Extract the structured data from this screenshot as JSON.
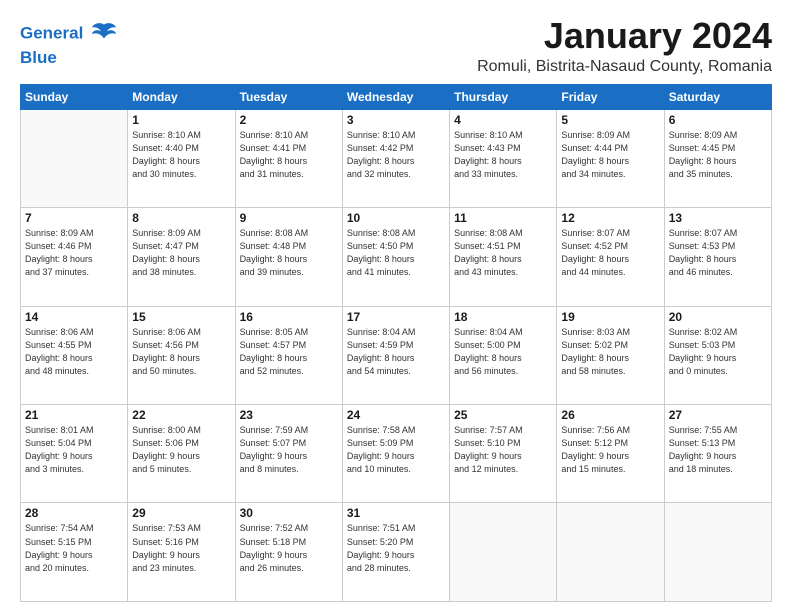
{
  "header": {
    "logo_line1": "General",
    "logo_line2": "Blue",
    "month_year": "January 2024",
    "location": "Romuli, Bistrita-Nasaud County, Romania"
  },
  "days_of_week": [
    "Sunday",
    "Monday",
    "Tuesday",
    "Wednesday",
    "Thursday",
    "Friday",
    "Saturday"
  ],
  "weeks": [
    [
      {
        "day": "",
        "info": ""
      },
      {
        "day": "1",
        "info": "Sunrise: 8:10 AM\nSunset: 4:40 PM\nDaylight: 8 hours\nand 30 minutes."
      },
      {
        "day": "2",
        "info": "Sunrise: 8:10 AM\nSunset: 4:41 PM\nDaylight: 8 hours\nand 31 minutes."
      },
      {
        "day": "3",
        "info": "Sunrise: 8:10 AM\nSunset: 4:42 PM\nDaylight: 8 hours\nand 32 minutes."
      },
      {
        "day": "4",
        "info": "Sunrise: 8:10 AM\nSunset: 4:43 PM\nDaylight: 8 hours\nand 33 minutes."
      },
      {
        "day": "5",
        "info": "Sunrise: 8:09 AM\nSunset: 4:44 PM\nDaylight: 8 hours\nand 34 minutes."
      },
      {
        "day": "6",
        "info": "Sunrise: 8:09 AM\nSunset: 4:45 PM\nDaylight: 8 hours\nand 35 minutes."
      }
    ],
    [
      {
        "day": "7",
        "info": "Sunrise: 8:09 AM\nSunset: 4:46 PM\nDaylight: 8 hours\nand 37 minutes."
      },
      {
        "day": "8",
        "info": "Sunrise: 8:09 AM\nSunset: 4:47 PM\nDaylight: 8 hours\nand 38 minutes."
      },
      {
        "day": "9",
        "info": "Sunrise: 8:08 AM\nSunset: 4:48 PM\nDaylight: 8 hours\nand 39 minutes."
      },
      {
        "day": "10",
        "info": "Sunrise: 8:08 AM\nSunset: 4:50 PM\nDaylight: 8 hours\nand 41 minutes."
      },
      {
        "day": "11",
        "info": "Sunrise: 8:08 AM\nSunset: 4:51 PM\nDaylight: 8 hours\nand 43 minutes."
      },
      {
        "day": "12",
        "info": "Sunrise: 8:07 AM\nSunset: 4:52 PM\nDaylight: 8 hours\nand 44 minutes."
      },
      {
        "day": "13",
        "info": "Sunrise: 8:07 AM\nSunset: 4:53 PM\nDaylight: 8 hours\nand 46 minutes."
      }
    ],
    [
      {
        "day": "14",
        "info": "Sunrise: 8:06 AM\nSunset: 4:55 PM\nDaylight: 8 hours\nand 48 minutes."
      },
      {
        "day": "15",
        "info": "Sunrise: 8:06 AM\nSunset: 4:56 PM\nDaylight: 8 hours\nand 50 minutes."
      },
      {
        "day": "16",
        "info": "Sunrise: 8:05 AM\nSunset: 4:57 PM\nDaylight: 8 hours\nand 52 minutes."
      },
      {
        "day": "17",
        "info": "Sunrise: 8:04 AM\nSunset: 4:59 PM\nDaylight: 8 hours\nand 54 minutes."
      },
      {
        "day": "18",
        "info": "Sunrise: 8:04 AM\nSunset: 5:00 PM\nDaylight: 8 hours\nand 56 minutes."
      },
      {
        "day": "19",
        "info": "Sunrise: 8:03 AM\nSunset: 5:02 PM\nDaylight: 8 hours\nand 58 minutes."
      },
      {
        "day": "20",
        "info": "Sunrise: 8:02 AM\nSunset: 5:03 PM\nDaylight: 9 hours\nand 0 minutes."
      }
    ],
    [
      {
        "day": "21",
        "info": "Sunrise: 8:01 AM\nSunset: 5:04 PM\nDaylight: 9 hours\nand 3 minutes."
      },
      {
        "day": "22",
        "info": "Sunrise: 8:00 AM\nSunset: 5:06 PM\nDaylight: 9 hours\nand 5 minutes."
      },
      {
        "day": "23",
        "info": "Sunrise: 7:59 AM\nSunset: 5:07 PM\nDaylight: 9 hours\nand 8 minutes."
      },
      {
        "day": "24",
        "info": "Sunrise: 7:58 AM\nSunset: 5:09 PM\nDaylight: 9 hours\nand 10 minutes."
      },
      {
        "day": "25",
        "info": "Sunrise: 7:57 AM\nSunset: 5:10 PM\nDaylight: 9 hours\nand 12 minutes."
      },
      {
        "day": "26",
        "info": "Sunrise: 7:56 AM\nSunset: 5:12 PM\nDaylight: 9 hours\nand 15 minutes."
      },
      {
        "day": "27",
        "info": "Sunrise: 7:55 AM\nSunset: 5:13 PM\nDaylight: 9 hours\nand 18 minutes."
      }
    ],
    [
      {
        "day": "28",
        "info": "Sunrise: 7:54 AM\nSunset: 5:15 PM\nDaylight: 9 hours\nand 20 minutes."
      },
      {
        "day": "29",
        "info": "Sunrise: 7:53 AM\nSunset: 5:16 PM\nDaylight: 9 hours\nand 23 minutes."
      },
      {
        "day": "30",
        "info": "Sunrise: 7:52 AM\nSunset: 5:18 PM\nDaylight: 9 hours\nand 26 minutes."
      },
      {
        "day": "31",
        "info": "Sunrise: 7:51 AM\nSunset: 5:20 PM\nDaylight: 9 hours\nand 28 minutes."
      },
      {
        "day": "",
        "info": ""
      },
      {
        "day": "",
        "info": ""
      },
      {
        "day": "",
        "info": ""
      }
    ]
  ]
}
